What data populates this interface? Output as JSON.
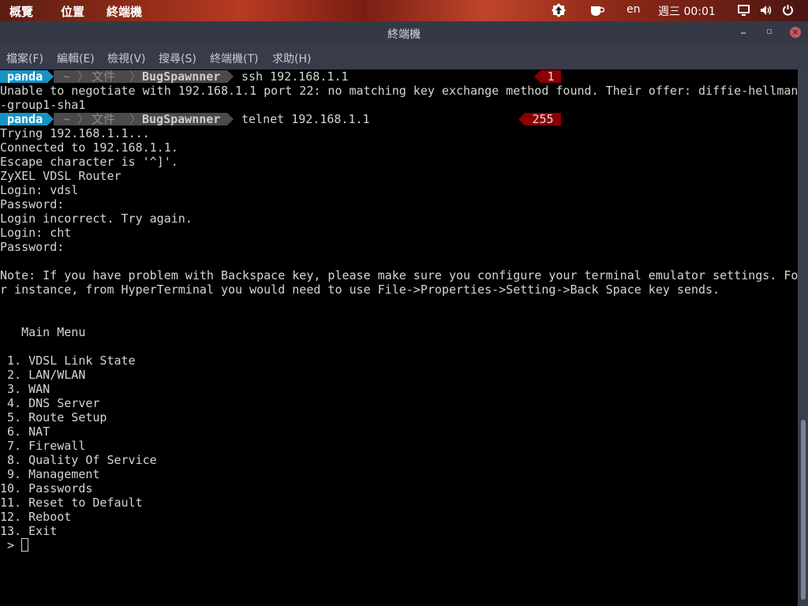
{
  "topbar": {
    "activities": "概覽",
    "places": "位置",
    "app": "終端機",
    "lang": "en",
    "clock": "週三 00:01",
    "icons": [
      "update-icon",
      "coffee-icon",
      "screen-icon",
      "volume-icon",
      "power-icon"
    ]
  },
  "window": {
    "title": "終端機"
  },
  "menu": [
    "檔案(F)",
    "編輯(E)",
    "檢視(V)",
    "搜尋(S)",
    "終端機(T)",
    "求助(H)"
  ],
  "prompt": {
    "user": "panda",
    "path": [
      "~",
      "文件",
      "BugSpawnner"
    ],
    "colors": {
      "user_bg": "#1793c3",
      "path_bg": "#4a4a4a",
      "error_bg": "#8b0000"
    }
  },
  "commands": [
    {
      "cmd": "ssh 192.168.1.1",
      "status": "1"
    },
    {
      "cmd": "telnet 192.168.1.1",
      "status": "255"
    }
  ],
  "ssh_output": [
    "Unable to negotiate with 192.168.1.1 port 22: no matching key exchange method found. Their offer: diffie-hellman",
    "-group1-sha1"
  ],
  "telnet_output": [
    "Trying 192.168.1.1...",
    "Connected to 192.168.1.1.",
    "Escape character is '^]'.",
    "ZyXEL VDSL Router",
    "Login: vdsl",
    "Password:",
    "Login incorrect. Try again.",
    "Login: cht",
    "Password:",
    "",
    "Note: If you have problem with Backspace key, please make sure you configure your terminal emulator settings. Fo",
    "r instance, from HyperTerminal you would need to use File->Properties->Setting->Back Space key sends.",
    "",
    "",
    "   Main Menu",
    "",
    " 1. VDSL Link State",
    " 2. LAN/WLAN",
    " 3. WAN",
    " 4. DNS Server",
    " 5. Route Setup",
    " 6. NAT",
    " 7. Firewall",
    " 8. Quality Of Service",
    " 9. Management",
    "10. Passwords",
    "11. Reset to Default",
    "12. Reboot",
    "13. Exit"
  ],
  "input_prompt": " > "
}
